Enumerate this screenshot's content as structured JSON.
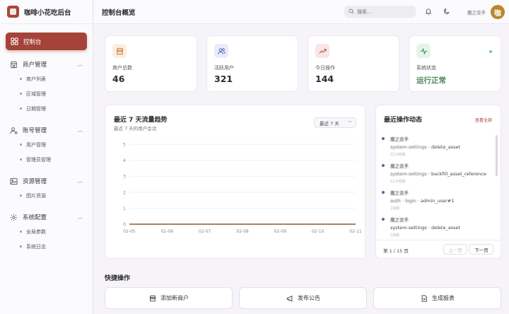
{
  "brand": {
    "title": "咖啡小花吃后台"
  },
  "sidebar": {
    "active": {
      "label": "控制台"
    },
    "groups": [
      {
        "label": "商户管理",
        "items": [
          "商户列表",
          "区域管理",
          "日期管理"
        ]
      },
      {
        "label": "账号管理",
        "items": [
          "用户管理",
          "管理员管理"
        ]
      },
      {
        "label": "资源管理",
        "items": [
          "图片资源"
        ]
      },
      {
        "label": "系统配置",
        "items": [
          "全局参数",
          "系统日志"
        ]
      }
    ]
  },
  "topbar": {
    "title": "控制台概览",
    "search_placeholder": "搜索...",
    "user_name": "魔之吉手",
    "avatar_text": "咖"
  },
  "stats": [
    {
      "label": "商户总数",
      "value": "46"
    },
    {
      "label": "活跃用户",
      "value": "321"
    },
    {
      "label": "今日操作",
      "value": "144"
    },
    {
      "label": "系统状态",
      "value": "运行正常"
    }
  ],
  "chart_card": {
    "title": "最近 7 天流量趋势",
    "subtitle": "最近 7 天的用户会话",
    "range": "最近 7 天"
  },
  "chart_data": {
    "type": "line",
    "x": [
      "02-05",
      "02-06",
      "02-07",
      "02-08",
      "02-09",
      "02-10",
      "02-11"
    ],
    "series": [
      {
        "values": [
          0,
          0,
          0,
          0,
          0,
          0,
          0
        ]
      }
    ],
    "yticks": [
      "5",
      "4",
      "3",
      "2",
      "1",
      "0"
    ],
    "ylim": [
      0,
      5
    ],
    "grid": true
  },
  "activity": {
    "title": "最近操作动态",
    "view_all": "查看全部",
    "items": [
      {
        "user": "魔之吉手",
        "source": "system-settings",
        "action": "delete_asset",
        "time": "11小时前"
      },
      {
        "user": "魔之吉手",
        "source": "system-settings",
        "action": "backfill_asset_reference",
        "time": "11小时前"
      },
      {
        "user": "魔之吉手",
        "source": "auth · login",
        "action": "admin_user#1",
        "time": "1天前"
      },
      {
        "user": "魔之吉手",
        "source": "system-settings",
        "action": "delete_asset",
        "time": "1天前"
      }
    ],
    "page_info": "第 1 / 15 页",
    "prev": "上一页",
    "next": "下一页"
  },
  "quick": {
    "title": "快捷操作",
    "buttons": [
      "添加新商户",
      "发布公告",
      "生成报表"
    ]
  },
  "colors": {
    "accent": "#a5433b",
    "status_ok": "#4b8a5c",
    "chart_line": "#8a5a3a"
  }
}
